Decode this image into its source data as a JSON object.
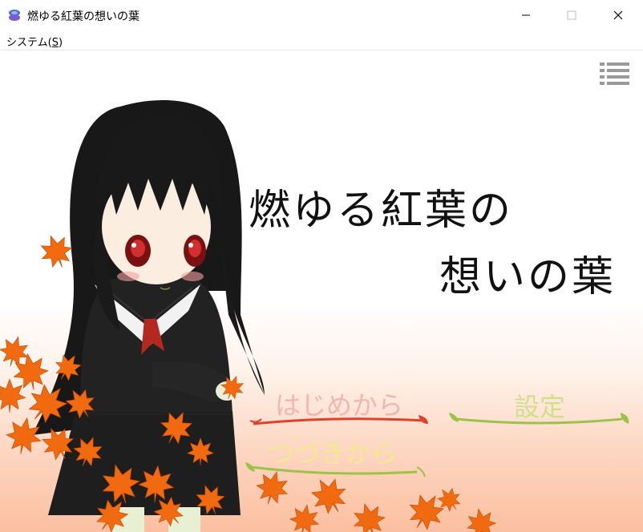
{
  "window": {
    "title": "燃ゆる紅葉の想いの葉"
  },
  "menubar": {
    "system_label": "システム(",
    "system_key": "S",
    "system_close": ")"
  },
  "game": {
    "title_line1": "燃ゆる紅葉の",
    "title_line2": "想いの葉",
    "menu": {
      "start": "はじめから",
      "continue": "つづきから",
      "settings": "設定"
    },
    "colors": {
      "start_text": "#f2b6ae",
      "start_underline": "#e0402a",
      "continue_text": "#f4e98e",
      "continue_underline": "#9cc24a",
      "settings_text": "#cfe08a",
      "settings_underline": "#9cc24a",
      "leaf": "#f26a10"
    }
  }
}
